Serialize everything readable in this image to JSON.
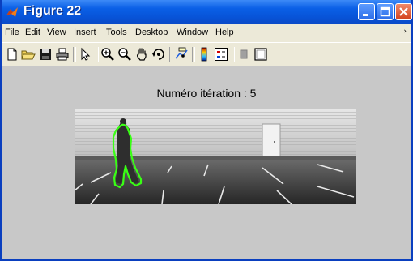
{
  "window": {
    "title": "Figure 22",
    "controls": {
      "minimize": "minimize-icon",
      "maximize": "maximize-icon",
      "close": "close-icon"
    }
  },
  "menubar": {
    "items": [
      {
        "label": "File"
      },
      {
        "label": "Edit"
      },
      {
        "label": "View"
      },
      {
        "label": "Insert"
      },
      {
        "label": "Tools"
      },
      {
        "label": "Desktop"
      },
      {
        "label": "Window"
      },
      {
        "label": "Help"
      }
    ]
  },
  "toolbar": {
    "tools": [
      {
        "icon": "new-figure-icon"
      },
      {
        "icon": "open-file-icon"
      },
      {
        "icon": "save-figure-icon"
      },
      {
        "icon": "print-figure-icon"
      },
      {
        "icon": "edit-plot-icon"
      },
      {
        "icon": "zoom-in-icon"
      },
      {
        "icon": "zoom-out-icon"
      },
      {
        "icon": "pan-icon"
      },
      {
        "icon": "rotate-3d-icon"
      },
      {
        "icon": "data-cursor-icon"
      },
      {
        "icon": "insert-colorbar-icon"
      },
      {
        "icon": "insert-legend-icon"
      },
      {
        "icon": "hide-plot-tools-icon"
      },
      {
        "icon": "show-plot-tools-icon"
      }
    ]
  },
  "figure": {
    "iteration_text": "Numéro itération :  5",
    "image_description_colors": {
      "contour": "#39ff14",
      "wall": "#d9d9d9",
      "ground": "#3c3c3c"
    }
  },
  "colors": {
    "title_bar": "#0a5fe6",
    "figure_bg": "#c8c8c8",
    "menu_bg": "#ece9d8"
  }
}
